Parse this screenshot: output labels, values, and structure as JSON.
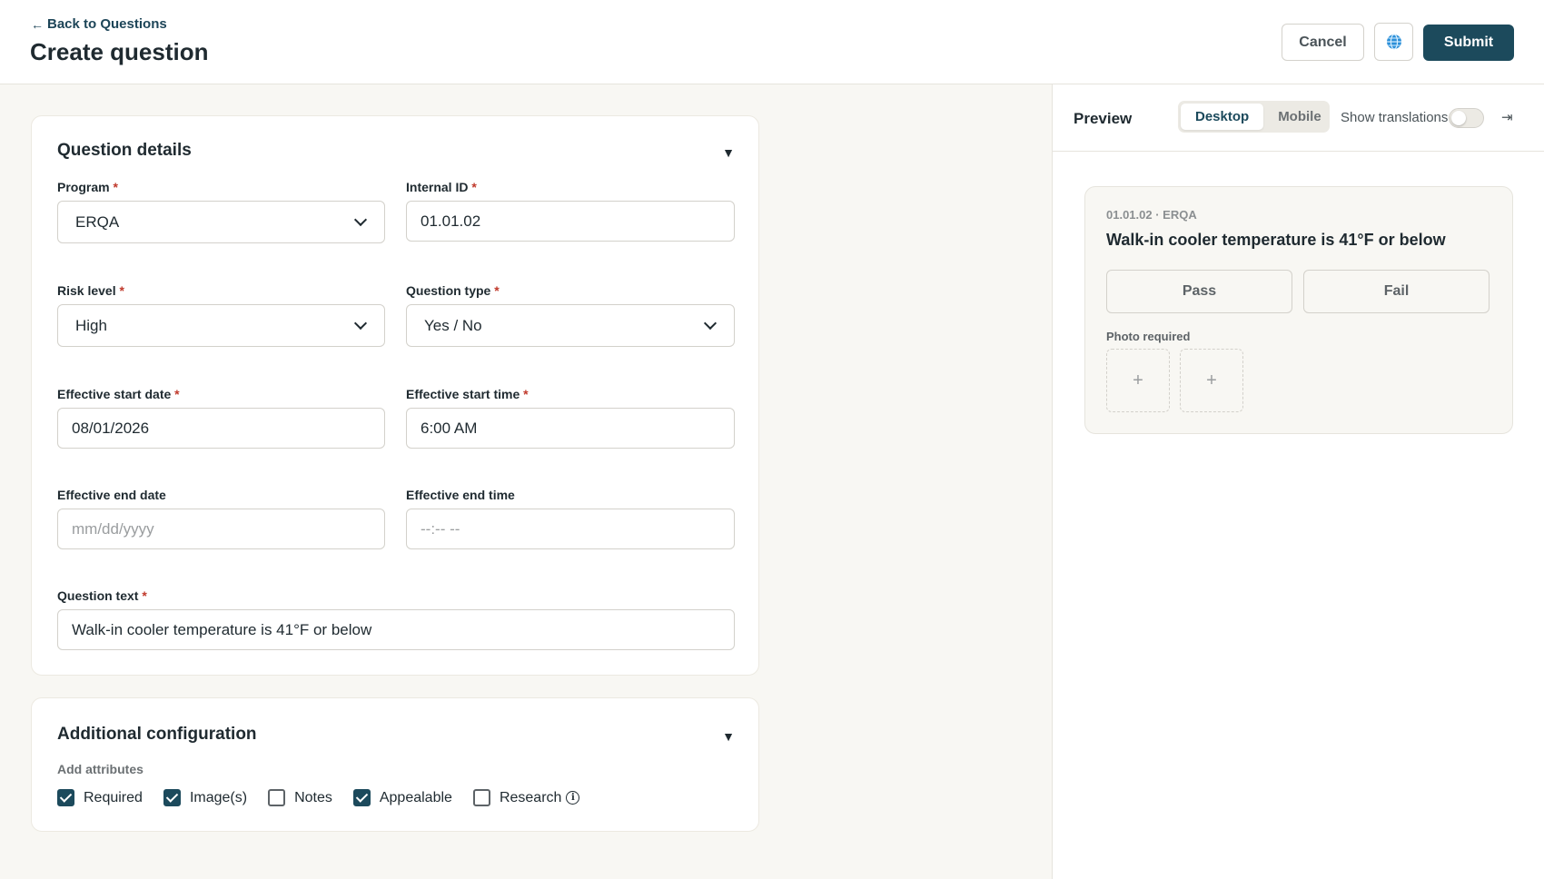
{
  "header": {
    "back_link": "Back to Questions",
    "back_arrow": "←",
    "title": "Create question",
    "cancel_label": "Cancel",
    "globe_icon": "globe-icon",
    "submit_label": "Submit"
  },
  "details": {
    "title": "Question details",
    "fields": {
      "program": {
        "label": "Program",
        "value": "ERQA"
      },
      "internal_id": {
        "label": "Internal ID",
        "value": "01.01.02"
      },
      "risk_level": {
        "label": "Risk level",
        "value": "High"
      },
      "question_type": {
        "label": "Question type",
        "value": "Yes / No"
      },
      "start_date": {
        "label": "Effective start date",
        "value": "08/01/2026"
      },
      "start_time": {
        "label": "Effective start time",
        "value": "6:00 AM"
      },
      "end_date": {
        "label": "Effective end date",
        "placeholder": "mm/dd/yyyy"
      },
      "end_time": {
        "label": "Effective end time",
        "placeholder": "--:-- --"
      },
      "question_text": {
        "label": "Question text",
        "value": "Walk-in cooler temperature is 41°F or below"
      }
    },
    "required_mark": "*"
  },
  "config": {
    "title": "Additional configuration",
    "attributes_label": "Add attributes",
    "attributes": [
      {
        "label": "Required",
        "checked": true
      },
      {
        "label": "Image(s)",
        "checked": true
      },
      {
        "label": "Notes",
        "checked": false
      },
      {
        "label": "Appealable",
        "checked": true
      },
      {
        "label": "Research",
        "checked": false
      }
    ],
    "info_glyph": "i"
  },
  "preview": {
    "title": "Preview",
    "tabs": [
      {
        "label": "Desktop",
        "active": true
      },
      {
        "label": "Mobile",
        "active": false
      }
    ],
    "show_translations_label": "Show translations",
    "show_translations_on": false,
    "collapse_glyph": "⇥",
    "card": {
      "meta": "01.01.02 · ERQA",
      "question": "Walk-in cooler temperature is 41°F or below",
      "pass_label": "Pass",
      "fail_label": "Fail",
      "photo_label": "Photo required",
      "add_glyph": "+"
    }
  },
  "colors": {
    "brand": "#1c4a5c",
    "required": "#c0392b",
    "page_bg": "#f8f7f3"
  }
}
